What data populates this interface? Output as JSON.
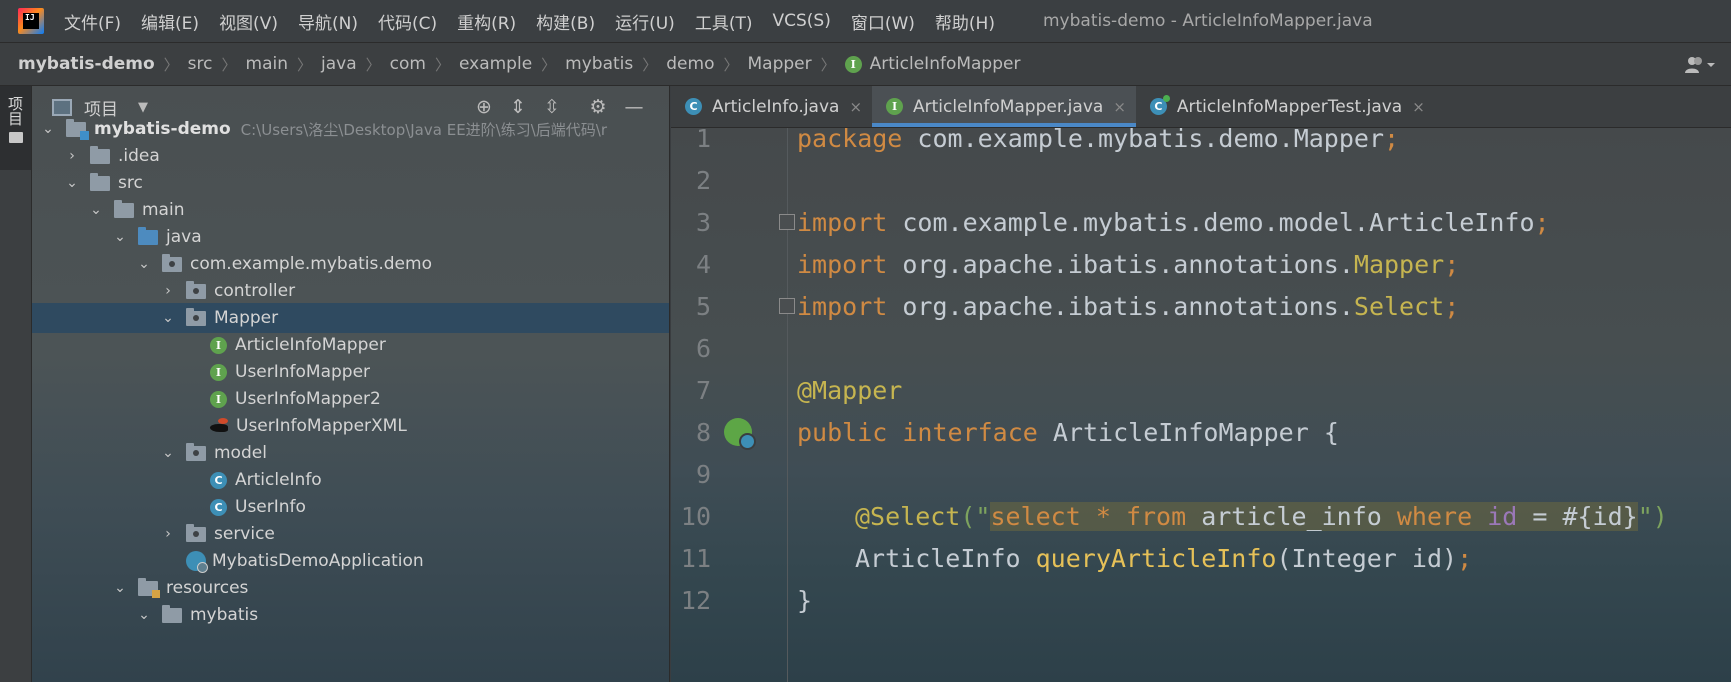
{
  "menubar": {
    "logo_text": "IJ",
    "items": [
      "文件(F)",
      "编辑(E)",
      "视图(V)",
      "导航(N)",
      "代码(C)",
      "重构(R)",
      "构建(B)",
      "运行(U)",
      "工具(T)",
      "VCS(S)",
      "窗口(W)",
      "帮助(H)"
    ],
    "window_title": "mybatis-demo - ArticleInfoMapper.java"
  },
  "breadcrumb": {
    "items": [
      "mybatis-demo",
      "src",
      "main",
      "java",
      "com",
      "example",
      "mybatis",
      "demo",
      "Mapper",
      "ArticleInfoMapper"
    ],
    "separator": "〉"
  },
  "side_strip": {
    "tab_label": "项目"
  },
  "project_panel": {
    "title": "项目",
    "dropdown_icon": "caret-down-icon",
    "header_buttons": [
      "crosshair-icon",
      "expand-all-icon",
      "collapse-all-icon",
      "gear-icon",
      "minimize-icon"
    ],
    "root_path": "C:\\Users\\洛尘\\Desktop\\Java EE进阶\\练习\\后端代码\\r",
    "tree": [
      {
        "label": "mybatis-demo",
        "chevron": "v",
        "icon": "module-folder"
      },
      {
        "label": ".idea",
        "chevron": ">",
        "icon": "folder"
      },
      {
        "label": "src",
        "chevron": "v",
        "icon": "folder"
      },
      {
        "label": "main",
        "chevron": "v",
        "icon": "folder"
      },
      {
        "label": "java",
        "chevron": "v",
        "icon": "source-folder"
      },
      {
        "label": "com.example.mybatis.demo",
        "chevron": "v",
        "icon": "package"
      },
      {
        "label": "controller",
        "chevron": ">",
        "icon": "package"
      },
      {
        "label": "Mapper",
        "chevron": "v",
        "icon": "package",
        "selected": true
      },
      {
        "label": "ArticleInfoMapper",
        "chevron": "",
        "icon": "interface"
      },
      {
        "label": "UserInfoMapper",
        "chevron": "",
        "icon": "interface"
      },
      {
        "label": "UserInfoMapper2",
        "chevron": "",
        "icon": "interface"
      },
      {
        "label": "UserInfoMapperXML",
        "chevron": "",
        "icon": "mybatis-xml"
      },
      {
        "label": "model",
        "chevron": "v",
        "icon": "package"
      },
      {
        "label": "ArticleInfo",
        "chevron": "",
        "icon": "class"
      },
      {
        "label": "UserInfo",
        "chevron": "",
        "icon": "class"
      },
      {
        "label": "service",
        "chevron": ">",
        "icon": "package"
      },
      {
        "label": "MybatisDemoApplication",
        "chevron": "",
        "icon": "spring-app"
      },
      {
        "label": "resources",
        "chevron": "v",
        "icon": "resources-folder"
      },
      {
        "label": "mybatis",
        "chevron": "v",
        "icon": "folder"
      }
    ]
  },
  "editor": {
    "tabs": [
      {
        "label": "ArticleInfo.java",
        "icon": "class",
        "active": false
      },
      {
        "label": "ArticleInfoMapper.java",
        "icon": "interface",
        "active": true
      },
      {
        "label": "ArticleInfoMapperTest.java",
        "icon": "test-class",
        "active": false
      }
    ],
    "close_glyph": "×",
    "line_numbers": [
      "1",
      "2",
      "3",
      "4",
      "5",
      "6",
      "7",
      "8",
      "9",
      "10",
      "11",
      "12"
    ],
    "code": {
      "l1_kw": "package",
      "l1_rest": " com.example.mybatis.demo.Mapper",
      "l3_kw": "import",
      "l3_rest": " com.example.mybatis.demo.model.ArticleInfo",
      "l4_kw": "import",
      "l4_rest": " org.apache.ibatis.annotations.",
      "l4_name": "Mapper",
      "l5_kw": "import",
      "l5_rest": " org.apache.ibatis.annotations.",
      "l5_name": "Select",
      "semicolon": ";",
      "l7_ann": "@Mapper",
      "l8_kw1": "public",
      "l8_kw2": "interface",
      "l8_name": " ArticleInfoMapper {",
      "l10_ann": "@Select",
      "l10_open": "(\"",
      "l10_select": "select",
      "l10_star": " * ",
      "l10_from": "from",
      "l10_table": " article_info ",
      "l10_where": "where",
      "l10_id": " id",
      "l10_cond": " = #{id}",
      "l10_close": "\")",
      "l11_type": "ArticleInfo ",
      "l11_method": "queryArticleInfo",
      "l11_params": "(Integer id)",
      "l12": "}"
    }
  }
}
